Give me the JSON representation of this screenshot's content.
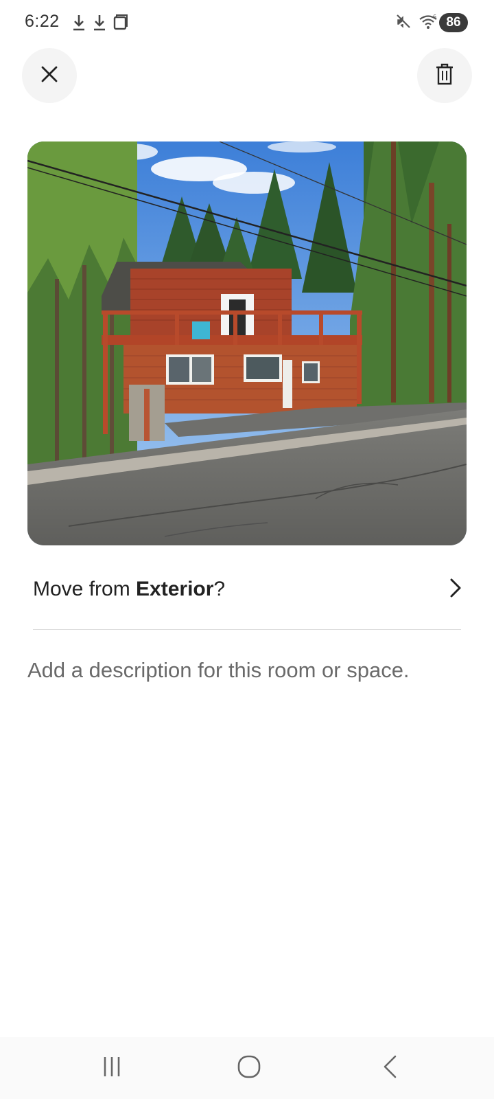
{
  "status_bar": {
    "time": "6:22",
    "battery": "86",
    "left_icons": [
      "download-icon",
      "download-icon",
      "screenshot-icon"
    ],
    "right_icons": [
      "mute-icon",
      "wifi-icon",
      "signal-icon"
    ]
  },
  "header": {
    "close_icon": "close-icon",
    "delete_icon": "trash-icon"
  },
  "photo": {
    "subject": "house-exterior-photo"
  },
  "move_row": {
    "prefix": "Move from ",
    "room": "Exterior",
    "suffix": "?",
    "chevron_icon": "chevron-right-icon"
  },
  "description": {
    "placeholder": "Add a description for this room or space.",
    "value": ""
  },
  "nav_bar": {
    "icons": [
      "recents-icon",
      "home-icon",
      "back-icon"
    ]
  },
  "colors": {
    "background": "#ffffff",
    "button_bg": "#f4f4f4",
    "text_primary": "#222222",
    "text_secondary": "#6a6a6a",
    "divider": "#dddddd"
  }
}
